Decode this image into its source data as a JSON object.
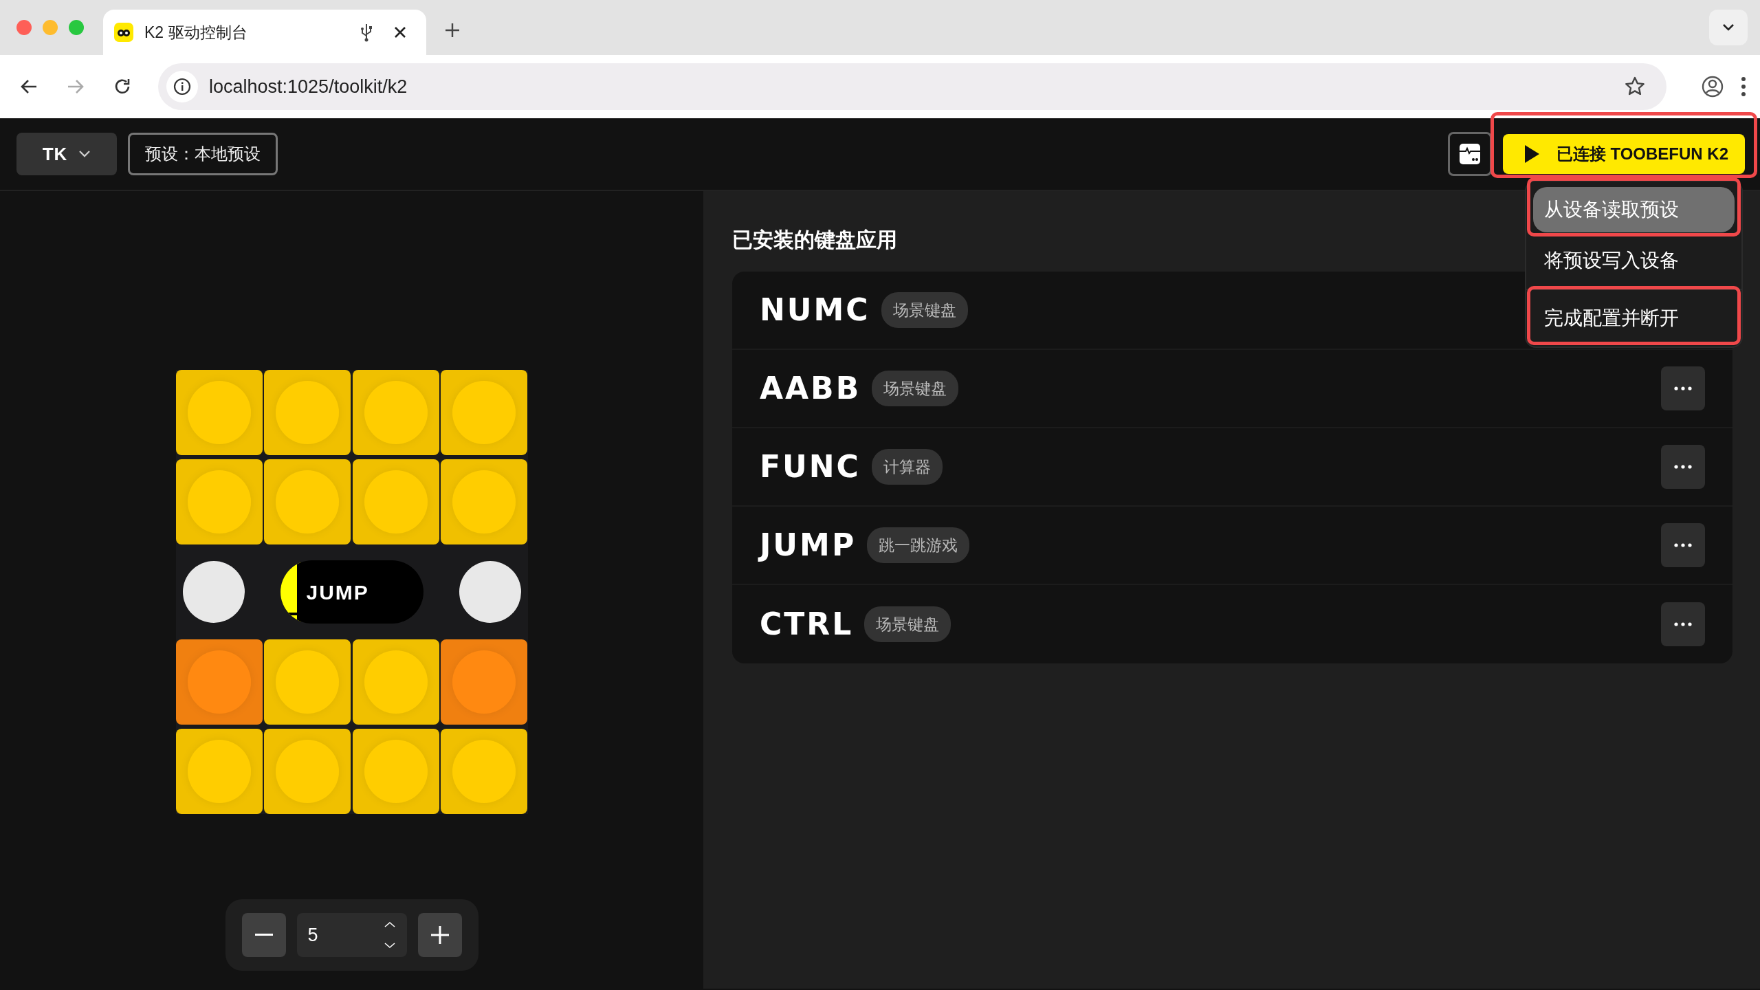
{
  "browser": {
    "tabs": [
      {
        "title": "K2 驱动控制台",
        "selected": true
      }
    ],
    "address": "localhost:1025/toolkit/k2"
  },
  "header": {
    "brand": "TK",
    "preset": "预设：本地预设",
    "connect_button": {
      "label": "已连接 TOOBEFUN K2",
      "highlighted": true
    }
  },
  "menu": {
    "items": [
      {
        "label": "从设备读取预设",
        "hovered": true,
        "highlighted": true
      },
      {
        "label": "将预设写入设备",
        "hovered": false,
        "highlighted": false
      },
      {
        "label": "完成配置并断开",
        "hovered": false,
        "highlighted": true
      }
    ]
  },
  "keyboard": {
    "rows": [
      {
        "kind": "keys",
        "keys": [
          {
            "color": "#f0c000"
          },
          {
            "color": "#f0c000"
          },
          {
            "color": "#f0c000"
          },
          {
            "color": "#f0c000"
          }
        ]
      },
      {
        "kind": "keys",
        "keys": [
          {
            "color": "#f0c000"
          },
          {
            "color": "#f0c000"
          },
          {
            "color": "#f0c000"
          },
          {
            "color": "#f0c000"
          }
        ]
      },
      {
        "kind": "display",
        "label": "JUMP"
      },
      {
        "kind": "keys",
        "keys": [
          {
            "color": "#f08010"
          },
          {
            "color": "#f0c000"
          },
          {
            "color": "#f0c000"
          },
          {
            "color": "#f08010"
          }
        ]
      },
      {
        "kind": "keys",
        "keys": [
          {
            "color": "#f0c000"
          },
          {
            "color": "#f0c000"
          },
          {
            "color": "#f0c000"
          },
          {
            "color": "#f0c000"
          }
        ]
      }
    ]
  },
  "stepper": {
    "value": "5"
  },
  "apps": {
    "title": "已安装的键盘应用",
    "items": [
      {
        "name": "NUMC",
        "tag": "场景键盘",
        "more_button": false
      },
      {
        "name": "AABB",
        "tag": "场景键盘",
        "more_button": true
      },
      {
        "name": "FUNC",
        "tag": "计算器",
        "more_button": true
      },
      {
        "name": "JUMP",
        "tag": "跳一跳游戏",
        "more_button": true
      },
      {
        "name": "CTRL",
        "tag": "场景键盘",
        "more_button": true
      }
    ]
  }
}
